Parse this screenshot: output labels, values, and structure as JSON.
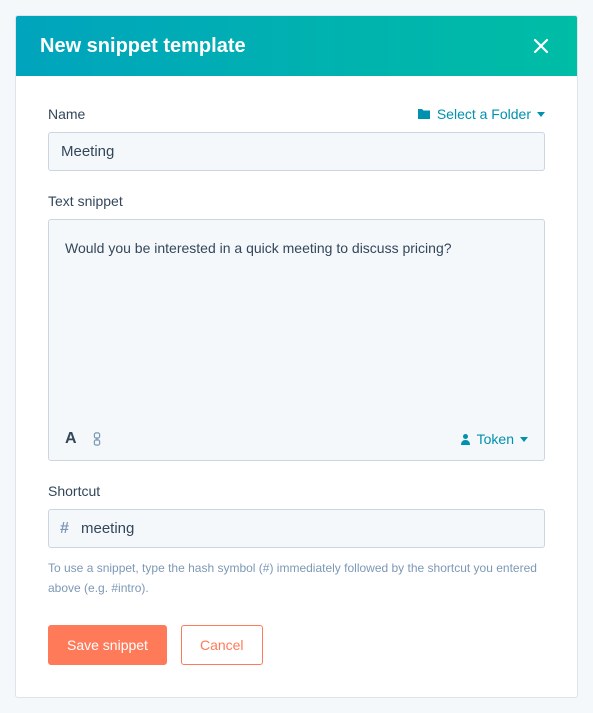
{
  "header": {
    "title": "New snippet template"
  },
  "fields": {
    "name": {
      "label": "Name",
      "value": "Meeting",
      "folder_select": "Select a Folder"
    },
    "snippet": {
      "label": "Text snippet",
      "content": "Would you be interested in a quick meeting to discuss pricing?",
      "token_label": "Token"
    },
    "shortcut": {
      "label": "Shortcut",
      "prefix": "#",
      "value": "meeting",
      "help": "To use a snippet, type the hash symbol (#) immediately followed by the shortcut you entered above (e.g. #intro)."
    }
  },
  "buttons": {
    "save": "Save snippet",
    "cancel": "Cancel"
  }
}
